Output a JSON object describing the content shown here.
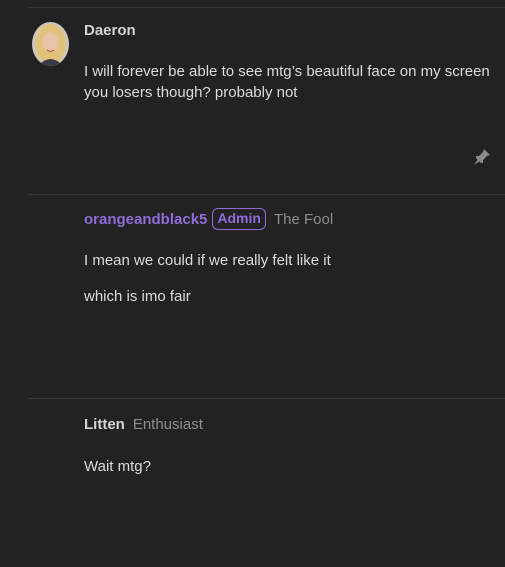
{
  "posts": [
    {
      "username": "Daeron",
      "lines": [
        "I will forever be able to see mtg’s beautiful face on my screen you losers though? probably not"
      ],
      "icon": "pin-icon"
    },
    {
      "username": "orangeandblack5",
      "badge": "Admin",
      "title": "The Fool",
      "lines": [
        "I mean we could if we really felt like it",
        "which is imo fair"
      ]
    },
    {
      "username": "Litten",
      "title": "Enthusiast",
      "lines": [
        "Wait mtg?"
      ]
    }
  ],
  "colors": {
    "background": "#222222",
    "admin_accent": "#8f6cd9",
    "text": "#dcdcdc",
    "muted": "#8d8d8d"
  }
}
